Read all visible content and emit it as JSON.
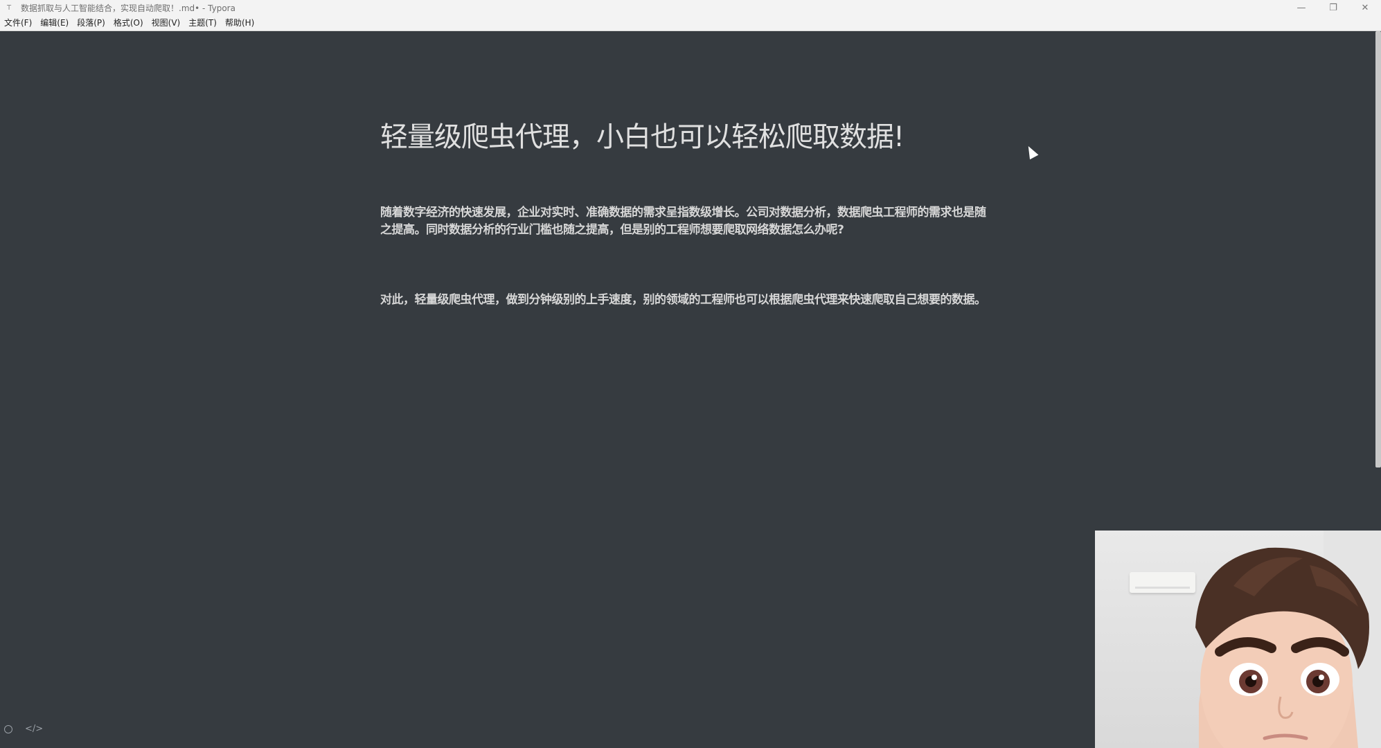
{
  "window": {
    "title": "数据抓取与人工智能结合，实现自动爬取！.md• - Typora",
    "app_icon": "typora-icon",
    "controls": {
      "minimize": "—",
      "restore": "❐",
      "close": "✕"
    }
  },
  "menu": {
    "items": [
      "文件(F)",
      "编辑(E)",
      "段落(P)",
      "格式(O)",
      "视图(V)",
      "主题(T)",
      "帮助(H)"
    ]
  },
  "document": {
    "title": "轻量级爬虫代理，小白也可以轻松爬取数据!",
    "paragraphs": [
      "随着数字经济的快速发展，企业对实时、准确数据的需求呈指数级增长。公司对数据分析，数据爬虫工程师的需求也是随之提高。同时数据分析的行业门槛也随之提高，但是别的工程师想要爬取网络数据怎么办呢?",
      "对此，轻量级爬虫代理，做到分钟级别的上手速度，别的领域的工程师也可以根据爬虫代理来快速爬取自己想要的数据。"
    ]
  },
  "statusbar": {
    "sidebar_toggle_icon": "circle-icon",
    "source_mode_label": "</>"
  },
  "colors": {
    "editor_bg": "#363b40",
    "text": "#d6d6d6",
    "chrome_bg": "#f3f3f3"
  }
}
